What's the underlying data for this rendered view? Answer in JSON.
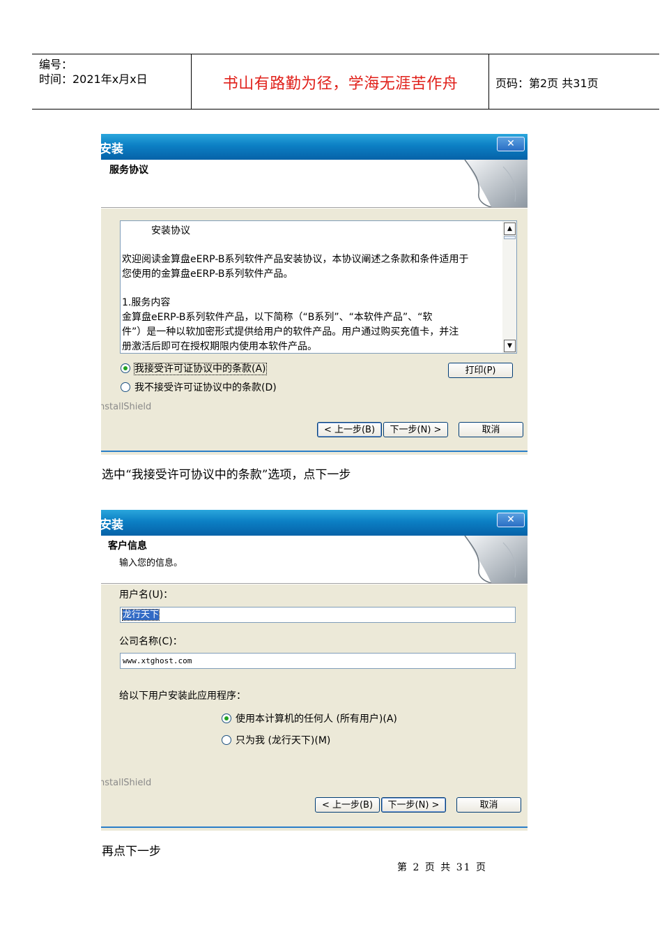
{
  "header": {
    "number_label": "编号：",
    "time_label": "时间：2021年x月x日",
    "motto": "书山有路勤为径，学海无涯苦作舟",
    "page_label": "页码：第2页  共31页"
  },
  "dialog1": {
    "title": "安装",
    "close": "✕",
    "section_title": "服务协议",
    "license_lines": [
      "　　　安装协议",
      "",
      "欢迎阅读金算盘eERP-B系列软件产品安装协议，本协议阐述之条款和条件适用于",
      "您使用的金算盘eERP-B系列软件产品。",
      "",
      "1.服务内容",
      "金算盘eERP-B系列软件产品，以下简称（“B系列”、“本软件产品”、“软",
      "件”）是一种以软加密形式提供给用户的软件产品。用户通过购买充值卡，并注",
      "册激活后即可在授权期限内使用本软件产品。"
    ],
    "radio_accept": "我接受许可证协议中的条款(A)",
    "radio_decline": "我不接受许可证协议中的条款(D)",
    "accept_selected": true,
    "print_button": "打印(P)",
    "installshield": "nstallShield",
    "back_button": "< 上一步(B)",
    "next_button": "下一步(N) >",
    "cancel_button": "取消"
  },
  "caption1": "选中“我接受许可协议中的条款”选项，点下一步",
  "dialog2": {
    "title": "安装",
    "close": "✕",
    "section_title": "客户信息",
    "section_subtitle": "输入您的信息。",
    "username_label": "用户名(U)：",
    "username_value": "龙行天下",
    "company_label": "公司名称(C)：",
    "company_value": "www.xtghost.com",
    "install_for_label": "给以下用户安装此应用程序：",
    "radio_all_users": "使用本计算机的任何人 (所有用户)(A)",
    "radio_only_me": "只为我 (龙行天下)(M)",
    "all_users_selected": true,
    "installshield": "nstallShield",
    "back_button": "< 上一步(B)",
    "next_button": "下一步(N) >",
    "cancel_button": "取消"
  },
  "caption2": "再点下一步",
  "footer": "第 2 页 共 31 页"
}
